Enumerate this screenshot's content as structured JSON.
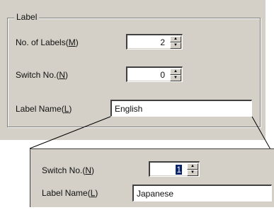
{
  "group": {
    "caption": "Label"
  },
  "fields": {
    "num_labels": {
      "label": "No. of Labels(",
      "mnemonic": "M",
      "close": ")",
      "value": "2"
    },
    "switch_no": {
      "label": "Switch No.(",
      "mnemonic": "N",
      "close": ")",
      "value": "0"
    },
    "label_name": {
      "label": "Label Name(",
      "mnemonic": "L",
      "close": ")",
      "value": "English"
    }
  },
  "zoom": {
    "switch_no": {
      "label": "Switch No.(",
      "mnemonic": "N",
      "close": ")",
      "value": "1"
    },
    "label_name": {
      "label": "Label Name(",
      "mnemonic": "L",
      "close": ")",
      "value": "Japanese"
    }
  },
  "icons": {
    "spin_up": "up-arrow-icon",
    "spin_down": "down-arrow-icon"
  }
}
